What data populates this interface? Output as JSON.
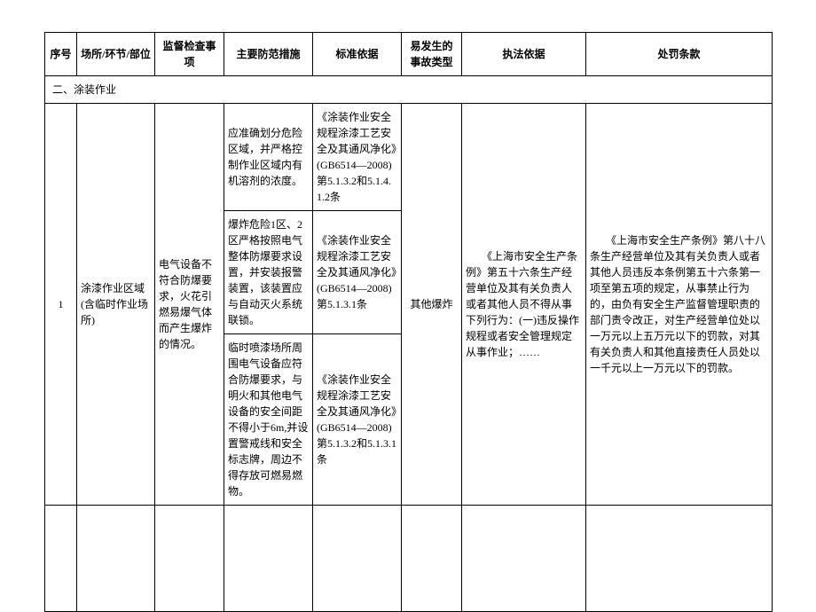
{
  "headers": {
    "seq": "序号",
    "location": "场所/环节/部位",
    "inspection": "监督检查事项",
    "measures": "主要防范措施",
    "standard": "标准依据",
    "accident_type": "易发生的事故类型",
    "enforcement": "执法依据",
    "penalty": "处罚条款"
  },
  "section": "二、涂装作业",
  "row": {
    "seq": "1",
    "location": "涂漆作业区域(含临时作业场所)",
    "inspection": "电气设备不符合防爆要求，火花引燃易爆气体而产生爆炸的情况。",
    "measures": [
      "应准确划分危险区域，并严格控制作业区域内有机溶剂的浓度。",
      "爆炸危险1区、2区严格按照电气整体防爆要求设置，并安装报警装置，该装置应与自动灭火系统联锁。",
      "临时喷漆场所周围电气设备应符合防爆要求，与明火和其他电气设备的安全间距不得小于6m,并设置警戒线和安全标志牌，周边不得存放可燃易燃物。"
    ],
    "standards": [
      "《涂装作业安全规程涂漆工艺安全及其通风净化》(GB6514—2008)第5.1.3.2和5.1.4.1.2条",
      "《涂装作业安全规程涂漆工艺安全及其通风净化》(GB6514—2008)第5.1.3.1条",
      "《涂装作业安全规程涂漆工艺安全及其通风净化》(GB6514—2008)第5.1.3.2和5.1.3.1条"
    ],
    "accident_type": "其他爆炸",
    "enforcement": "　　《上海市安全生产条例》第五十六条生产经营单位及其有关负责人或者其他人员不得从事下列行为：(一)违反操作规程或者安全管理规定从事作业；……",
    "penalty": "　　《上海市安全生产条例》第八十八条生产经营单位及其有关负责人或者其他人员违反本条例第五十六条第一项至第五项的规定，从事禁止行为的，由负有安全生产监督管理职责的部门责令改正，对生产经营单位处以一万元以上五万元以下的罚款，对其有关负责人和其他直接责任人员处以一千元以上一万元以下的罚款。"
  }
}
